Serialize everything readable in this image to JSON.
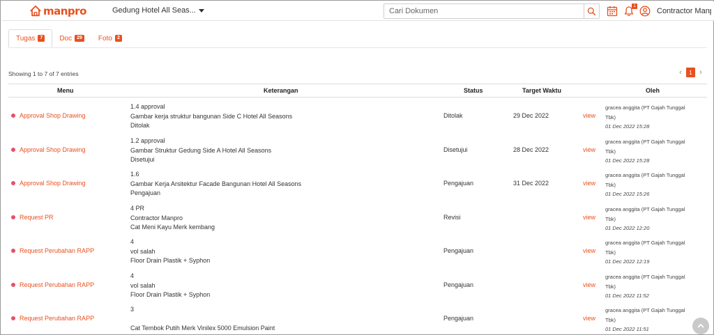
{
  "header": {
    "logo_text": "manpro",
    "project_name": "Gedung Hotel All Seas...",
    "search_placeholder": "Cari Dokumen",
    "notification_count": "1",
    "user_name": "Contractor Manp"
  },
  "tabs": [
    {
      "label": "Tugas",
      "count": "7"
    },
    {
      "label": "Doc",
      "count": "29"
    },
    {
      "label": "Foto",
      "count": "2"
    }
  ],
  "table": {
    "entries_text": "Showing 1 to 7 of 7 entries",
    "pagination": {
      "prev": "‹",
      "current": "1",
      "next": "›"
    },
    "columns": {
      "menu": "Menu",
      "keterangan": "Keterangan",
      "status": "Status",
      "target": "Target Waktu",
      "oleh": "Oleh"
    },
    "view_label": "view",
    "rows": [
      {
        "menu": "Approval Shop Drawing",
        "ket1": "1.4 approval",
        "ket2": "Gambar kerja struktur bangunan Side C Hotel All Seasons",
        "ket3": "Ditolak",
        "status": "Ditolak",
        "target": "29 Dec 2022",
        "oleh1": "gracea anggita (PT Gajah Tunggal",
        "oleh2": "Tbk)",
        "date": "01 Dec 2022 15:28"
      },
      {
        "menu": "Approval Shop Drawing",
        "ket1": "1.2 approval",
        "ket2": "Gambar Struktur Gedung Side A Hotel All Seasons",
        "ket3": "Disetujui",
        "status": "Disetujui",
        "target": "28 Dec 2022",
        "oleh1": "gracea anggita (PT Gajah Tunggal",
        "oleh2": "Tbk)",
        "date": "01 Dec 2022 15:28"
      },
      {
        "menu": "Approval Shop Drawing",
        "ket1": "1.6",
        "ket2": "Gambar Kerja Arsitektur Facade Bangunan Hotel All Seasons",
        "ket3": "Pengajuan",
        "status": "Pengajuan",
        "target": "31 Dec 2022",
        "oleh1": "gracea anggita (PT Gajah Tunggal",
        "oleh2": "Tbk)",
        "date": "01 Dec 2022 15:26"
      },
      {
        "menu": "Request PR",
        "ket1": "4 PR",
        "ket2": "Contractor Manpro",
        "ket3": "Cat Meni Kayu Merk kembang",
        "status": "Revisi",
        "target": "",
        "oleh1": "gracea anggita (PT Gajah Tunggal",
        "oleh2": "Tbk)",
        "date": "01 Dec 2022 12:20"
      },
      {
        "menu": "Request Perubahan RAPP",
        "ket1": "4",
        "ket2": "vol salah",
        "ket3": "Floor Drain Plastik + Syphon",
        "status": "Pengajuan",
        "target": "",
        "oleh1": "gracea anggita (PT Gajah Tunggal",
        "oleh2": "Tbk)",
        "date": "01 Dec 2022 12:19"
      },
      {
        "menu": "Request Perubahan RAPP",
        "ket1": "4",
        "ket2": "vol salah",
        "ket3": "Floor Drain Plastik + Syphon",
        "status": "Pengajuan",
        "target": "",
        "oleh1": "gracea anggita (PT Gajah Tunggal",
        "oleh2": "Tbk)",
        "date": "01 Dec 2022 11:52"
      },
      {
        "menu": "Request Perubahan RAPP",
        "ket1": "3",
        "ket2": "",
        "ket3": "Cat Tembok Putih Merk Vinilex 5000 Emulsion Paint",
        "status": "Pengajuan",
        "target": "",
        "oleh1": "gracea anggita (PT Gajah Tunggal",
        "oleh2": "Tbk)",
        "date": "01 Dec 2022 11:51"
      }
    ]
  },
  "icons": {
    "logo": "house-icon",
    "search": "search-icon",
    "calendar": "calendar-icon",
    "bell": "bell-icon",
    "user": "user-circle-icon",
    "scroll_top": "chevron-up-icon"
  },
  "colors": {
    "accent": "#e8501f",
    "dot": "#e8506a"
  }
}
